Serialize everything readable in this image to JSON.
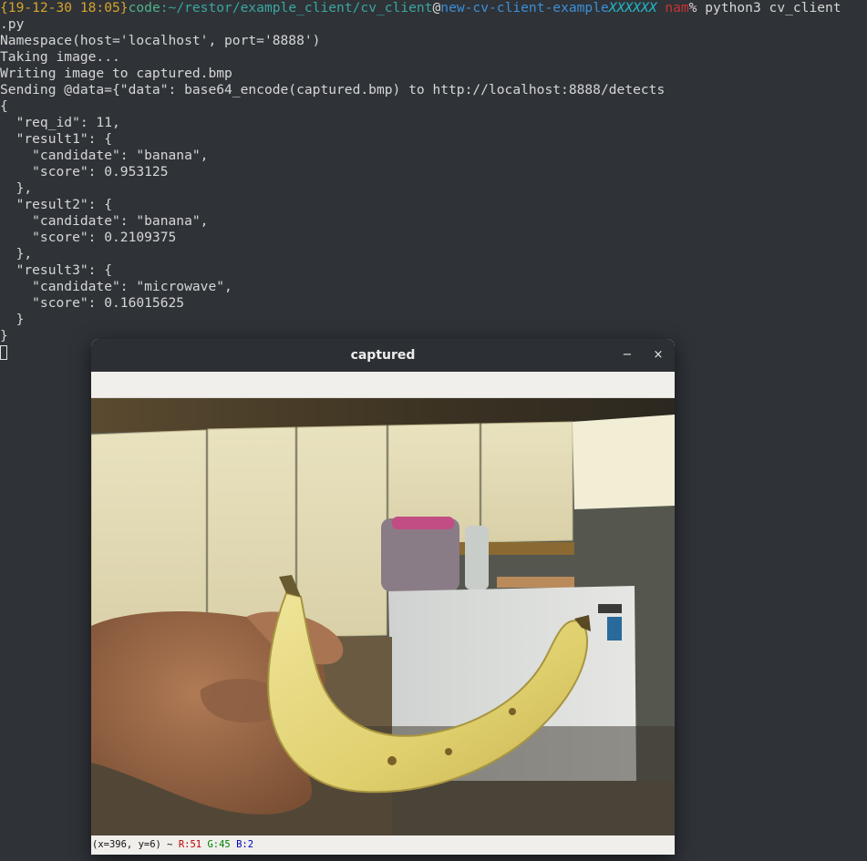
{
  "terminal": {
    "prompt": {
      "timestamp": "{19-12-30 18:05}",
      "user": "code",
      "path": ":~/restor/example_client/cv_client",
      "at": "@",
      "host": "new-cv-client-example",
      "mask1": "XXXXXX",
      "mask2": "nam",
      "symbol": "% ",
      "command": "python3 cv_client"
    },
    "lines": [
      ".py",
      "Namespace(host='localhost', port='8888')",
      "Taking image...",
      "Writing image to captured.bmp",
      "Sending @data={\"data\": base64_encode(captured.bmp) to http://localhost:8888/detects",
      "{",
      "  \"req_id\": 11,",
      "  \"result1\": {",
      "    \"candidate\": \"banana\",",
      "    \"score\": 0.953125",
      "  },",
      "  \"result2\": {",
      "    \"candidate\": \"banana\",",
      "    \"score\": 0.2109375",
      "  },",
      "  \"result3\": {",
      "    \"candidate\": \"microwave\",",
      "    \"score\": 0.16015625",
      "  }",
      "}"
    ]
  },
  "window": {
    "title": "captured",
    "minimize_icon": "minimize-icon",
    "close_icon": "close-icon",
    "minimize_glyph": "−",
    "close_glyph": "×",
    "status": {
      "coords": "(x=396, y=6) ~ ",
      "r": "R:51",
      "g": "G:45",
      "b": "B:2"
    }
  },
  "photo": {
    "scene": "banana held in hand in front of kitchen cabinets and microwave",
    "colors": {
      "ceiling": "#3a3226",
      "cabinet": "#e4dcb8",
      "wall": "#5c5e58",
      "microwave": "#d8d9d6",
      "banana": "#e6d77a",
      "hand": "#9a6a48"
    }
  }
}
